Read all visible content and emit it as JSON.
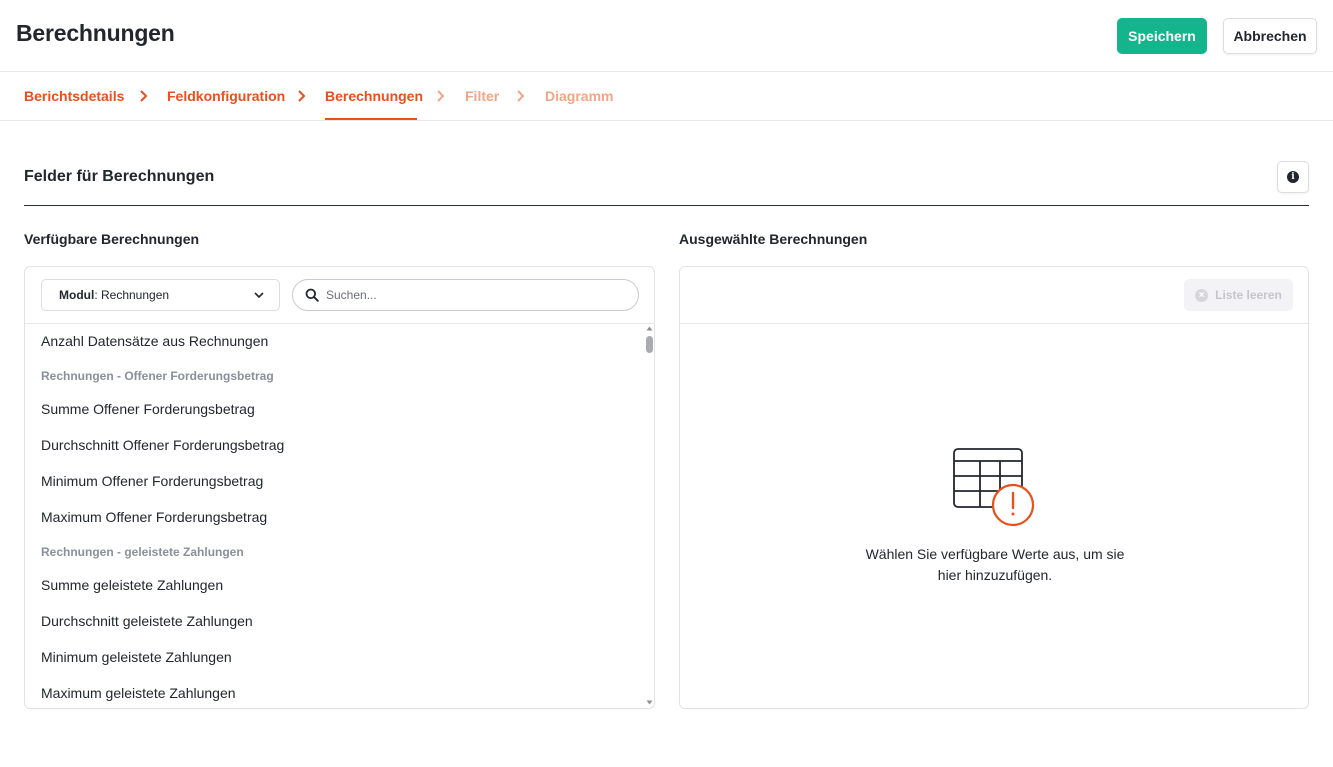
{
  "header": {
    "title": "Berechnungen",
    "save_label": "Speichern",
    "cancel_label": "Abbrechen"
  },
  "steps": [
    {
      "label": "Berichtsdetails",
      "state": "done"
    },
    {
      "label": "Feldkonfiguration",
      "state": "done"
    },
    {
      "label": "Berechnungen",
      "state": "active"
    },
    {
      "label": "Filter",
      "state": "future"
    },
    {
      "label": "Diagramm",
      "state": "future"
    }
  ],
  "section": {
    "title": "Felder für Berechnungen",
    "info_icon": "info-icon"
  },
  "available": {
    "label": "Verfügbare Berechnungen",
    "module_prefix": "Modul",
    "module_value": ": Rechnungen",
    "search_placeholder": "Suchen...",
    "items": [
      {
        "type": "item",
        "text": "Anzahl Datensätze aus Rechnungen"
      },
      {
        "type": "group",
        "text": "Rechnungen - Offener Forderungsbetrag"
      },
      {
        "type": "item",
        "text": "Summe Offener Forderungsbetrag"
      },
      {
        "type": "item",
        "text": "Durchschnitt Offener Forderungsbetrag"
      },
      {
        "type": "item",
        "text": "Minimum Offener Forderungsbetrag"
      },
      {
        "type": "item",
        "text": "Maximum Offener Forderungsbetrag"
      },
      {
        "type": "group",
        "text": "Rechnungen - geleistete Zahlungen"
      },
      {
        "type": "item",
        "text": "Summe geleistete Zahlungen"
      },
      {
        "type": "item",
        "text": "Durchschnitt geleistete Zahlungen"
      },
      {
        "type": "item",
        "text": "Minimum geleistete Zahlungen"
      },
      {
        "type": "item",
        "text": "Maximum geleistete Zahlungen"
      }
    ]
  },
  "selected": {
    "label": "Ausgewählte Berechnungen",
    "clear_label": "Liste leeren",
    "empty_line1": "Wählen Sie verfügbare Werte aus, um sie",
    "empty_line2": "hier hinzuzufügen."
  },
  "colors": {
    "accent": "#e8501c",
    "accent_light": "#f2a585",
    "primary_button": "#14b48c"
  }
}
